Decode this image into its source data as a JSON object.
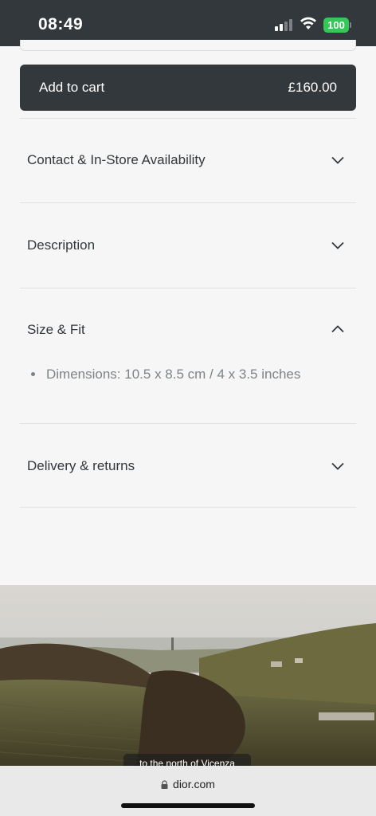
{
  "status_bar": {
    "time": "08:49",
    "battery": "100"
  },
  "cart": {
    "label": "Add to cart",
    "price": "£160.00"
  },
  "accordion": [
    {
      "title": "Contact & In-Store Availability",
      "expanded": false
    },
    {
      "title": "Description",
      "expanded": false
    },
    {
      "title": "Size & Fit",
      "expanded": true
    },
    {
      "title": "Delivery & returns",
      "expanded": false
    }
  ],
  "size_fit": {
    "dimensions": "Dimensions: 10.5 x 8.5 cm / 4 x 3.5 inches"
  },
  "video": {
    "caption": "to the north of Vicenza"
  },
  "browser": {
    "url": "dior.com"
  }
}
